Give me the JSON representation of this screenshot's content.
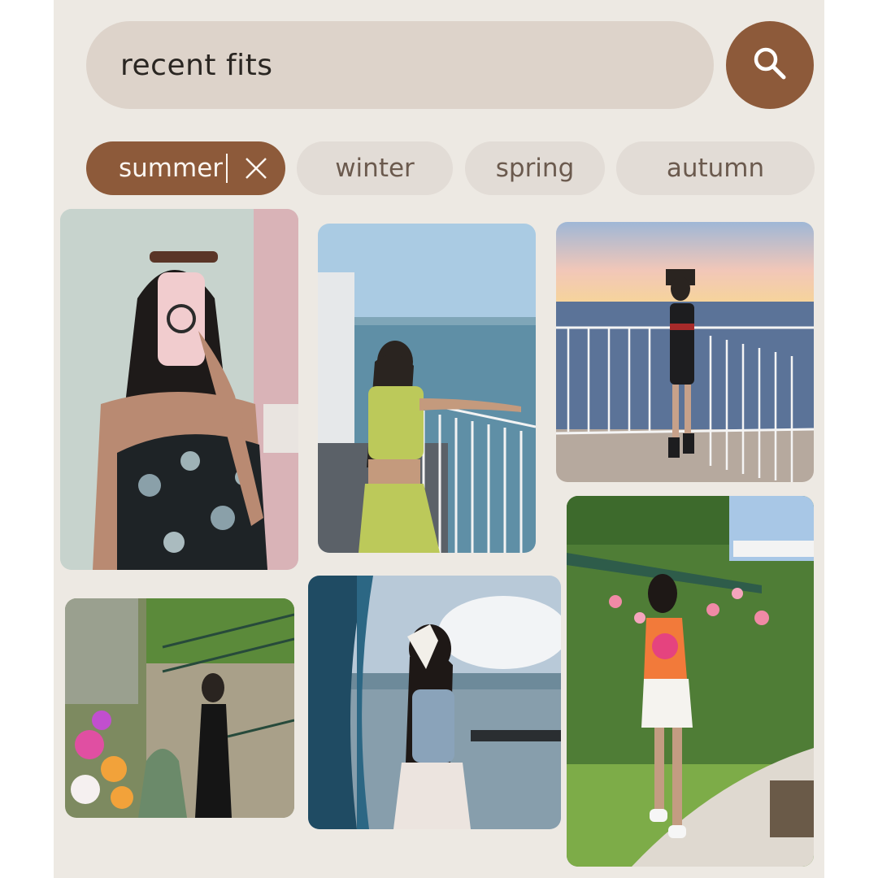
{
  "search": {
    "query": "recent fits",
    "button_icon": "search-icon"
  },
  "filters": [
    {
      "label": "summer",
      "selected": true,
      "clear_icon": "close-icon"
    },
    {
      "label": "winter",
      "selected": false
    },
    {
      "label": "spring",
      "selected": false
    },
    {
      "label": "autumn",
      "selected": false
    }
  ],
  "photos": [
    {
      "name": "photo-mirror-selfie-floral-dress"
    },
    {
      "name": "photo-green-top-ship-deck"
    },
    {
      "name": "photo-black-dress-sunset-railing"
    },
    {
      "name": "photo-black-dress-flower-garden"
    },
    {
      "name": "photo-white-bow-cable-car"
    },
    {
      "name": "photo-crochet-top-garden-path"
    }
  ],
  "colors": {
    "accent": "#8d5a3a",
    "chip_bg": "#e2dcd6",
    "search_bg": "#ddd3ca",
    "page_bg": "#ede9e3"
  }
}
